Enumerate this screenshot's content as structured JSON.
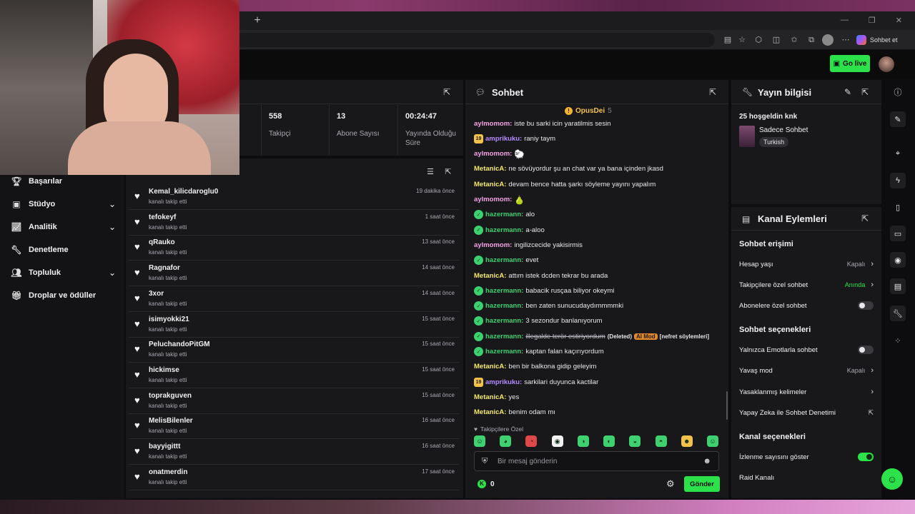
{
  "browser": {
    "new_tab_label": "+",
    "copilot_label": "Sohbet et"
  },
  "header": {
    "go_live_label": "Go live"
  },
  "sidebar": {
    "items": [
      {
        "label": "Başarılar",
        "icon": "trophy-icon"
      },
      {
        "label": "Stüdyo",
        "icon": "studio-icon",
        "expandable": true
      },
      {
        "label": "Analitik",
        "icon": "chart-icon",
        "expandable": true
      },
      {
        "label": "Denetleme",
        "icon": "wrench-icon"
      },
      {
        "label": "Topluluk",
        "icon": "users-icon",
        "expandable": true
      },
      {
        "label": "Droplar ve ödüller",
        "icon": "gift-icon"
      }
    ]
  },
  "stats": [
    {
      "value": "558",
      "label": "Takipçi"
    },
    {
      "value": "13",
      "label": "Abone Sayısı"
    },
    {
      "value": "00:24:47",
      "label": "Yayında Olduğu Süre"
    }
  ],
  "followers": {
    "subtitle": "kanalı takip etti",
    "rows": [
      {
        "name": "Kemal_kilicdaroglu0",
        "time": "19 dakika önce"
      },
      {
        "name": "tefokeyf",
        "time": "1 saat önce"
      },
      {
        "name": "qRauko",
        "time": "13 saat önce"
      },
      {
        "name": "Ragnafor",
        "time": "14 saat önce"
      },
      {
        "name": "3xor",
        "time": "14 saat önce"
      },
      {
        "name": "isimyokki21",
        "time": "15 saat önce"
      },
      {
        "name": "PeluchandoPitGM",
        "time": "15 saat önce"
      },
      {
        "name": "hickimse",
        "time": "15 saat önce"
      },
      {
        "name": "toprakguven",
        "time": "15 saat önce"
      },
      {
        "name": "MelisBilenler",
        "time": "16 saat önce"
      },
      {
        "name": "bayyigittt",
        "time": "16 saat önce"
      },
      {
        "name": "onatmerdin",
        "time": "17 saat önce"
      }
    ]
  },
  "chat": {
    "title": "Sohbet",
    "pinned_user": "OpusDei",
    "pinned_count": "5",
    "messages": [
      {
        "user": "aylmomom",
        "color": "#f5a4e6",
        "badge": "",
        "text": "iste bu sarki icin yaratilmis sesin"
      },
      {
        "user": "amprikuku",
        "color": "#b48cff",
        "badge": "sub",
        "badge_text": "19",
        "text": "raniy taym"
      },
      {
        "user": "aylmomom",
        "color": "#f5a4e6",
        "badge": "",
        "text": "",
        "emote": "🐑"
      },
      {
        "user": "MetanicA",
        "color": "#f5e96b",
        "badge": "",
        "text": "ne sövüyordur şu an chat var ya bana içinden jkasd"
      },
      {
        "user": "MetanicA",
        "color": "#f5e96b",
        "badge": "",
        "text": "devam bence hatta şarkı söyleme yayını yapalım"
      },
      {
        "user": "aylmomom",
        "color": "#f5a4e6",
        "badge": "",
        "text": "",
        "emote": "🍐"
      },
      {
        "user": "hazermann",
        "color": "#3bd16f",
        "badge": "ver",
        "text": "alo"
      },
      {
        "user": "hazermann",
        "color": "#3bd16f",
        "badge": "ver",
        "text": "a-aloo"
      },
      {
        "user": "aylmomom",
        "color": "#f5a4e6",
        "badge": "",
        "text": "ingilizcecide yakisirmis"
      },
      {
        "user": "hazermann",
        "color": "#3bd16f",
        "badge": "ver",
        "text": "evet"
      },
      {
        "user": "MetanicA",
        "color": "#f5e96b",
        "badge": "",
        "text": "attım istek dcden tekrar bu arada"
      },
      {
        "user": "hazermann",
        "color": "#3bd16f",
        "badge": "ver",
        "text": "babacik rusçaa biliyor okeymi"
      },
      {
        "user": "hazermann",
        "color": "#3bd16f",
        "badge": "ver",
        "text": "ben zaten sunucudaydımmmmki"
      },
      {
        "user": "hazermann",
        "color": "#3bd16f",
        "badge": "ver",
        "text": "3 sezondur banlanıyorum"
      },
      {
        "user": "hazermann",
        "color": "#3bd16f",
        "badge": "ver",
        "text": "illegalde terör estiriyordum",
        "deleted": true,
        "deleted_label": "(Deleted)",
        "aimod_label": "AI Mod",
        "reason": "[nefret söylemleri]"
      },
      {
        "user": "hazermann",
        "color": "#3bd16f",
        "badge": "ver",
        "text": "kaptan falan kaçırıyordum"
      },
      {
        "user": "MetanicA",
        "color": "#f5e96b",
        "badge": "",
        "text": "ben bir balkona gidip geleyim"
      },
      {
        "user": "amprikuku",
        "color": "#b48cff",
        "badge": "sub",
        "badge_text": "19",
        "text": "sarkilari duyunca kactilar"
      },
      {
        "user": "MetanicA",
        "color": "#f5e96b",
        "badge": "",
        "text": "yes"
      },
      {
        "user": "MetanicA",
        "color": "#f5e96b",
        "badge": "",
        "text": "benim odam mı"
      }
    ],
    "followers_only_label": "Takipçilere Özel",
    "input_placeholder": "Bir mesaj gönderin",
    "points": "0",
    "send_label": "Gönder"
  },
  "stream_info": {
    "title": "Yayın bilgisi",
    "stream_title": "25 hoşgeldin knk",
    "category": "Sadece Sohbet",
    "language": "Turkish"
  },
  "channel_actions": {
    "title": "Kanal Eylemleri",
    "sections": {
      "chat_access": "Sohbet erişimi",
      "chat_options": "Sohbet seçenekleri",
      "channel_options": "Kanal seçenekleri"
    },
    "account_age": {
      "label": "Hesap yaşı",
      "value": "Kapalı"
    },
    "followers_only": {
      "label": "Takipçilere özel sohbet",
      "value": "Anında"
    },
    "subs_only": {
      "label": "Abonelere özel sohbet"
    },
    "emote_only": {
      "label": "Yalnızca Emotlarla sohbet"
    },
    "slow_mode": {
      "label": "Yavaş mod",
      "value": "Kapalı"
    },
    "banned_words": {
      "label": "Yasaklanmış kelimeler"
    },
    "ai_moderation": {
      "label": "Yapay Zeka ile Sohbet Denetimi"
    },
    "show_viewers": {
      "label": "İzlenme sayısını göster"
    },
    "raid": {
      "label": "Raid Kanalı"
    }
  },
  "colors": {
    "accent": "#2be24a",
    "panel": "#18181b",
    "bg": "#0d0d0f"
  }
}
